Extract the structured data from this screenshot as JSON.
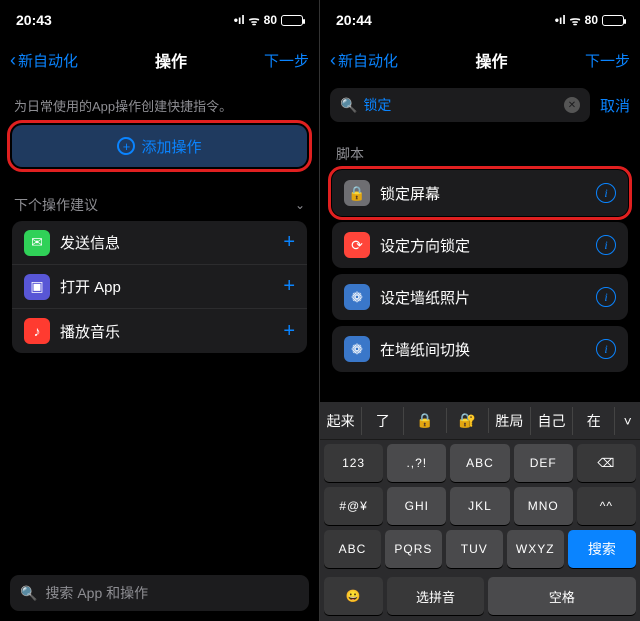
{
  "left": {
    "status": {
      "time": "20:43",
      "battery": "80"
    },
    "nav": {
      "back": "新自动化",
      "title": "操作",
      "next": "下一步"
    },
    "subtitle": "为日常使用的App操作创建快捷指令。",
    "add_action": "添加操作",
    "suggest_header": "下个操作建议",
    "suggestions": [
      {
        "label": "发送信息"
      },
      {
        "label": "打开 App"
      },
      {
        "label": "播放音乐"
      }
    ],
    "search_placeholder": "搜索 App 和操作"
  },
  "right": {
    "status": {
      "time": "20:44",
      "battery": "80"
    },
    "nav": {
      "back": "新自动化",
      "title": "操作",
      "next": "下一步"
    },
    "search": {
      "value": "锁定",
      "cancel": "取消"
    },
    "script_header": "脚本",
    "scripts": [
      {
        "label": "锁定屏幕",
        "highlight": true
      },
      {
        "label": "设定方向锁定"
      },
      {
        "label": "设定墙纸照片"
      },
      {
        "label": "在墙纸间切换"
      }
    ],
    "keyboard": {
      "suggestions": [
        "起来",
        "了",
        "🔒",
        "🔐",
        "胜局",
        "自己",
        "在",
        "˅"
      ],
      "rows": [
        [
          "123",
          ".,?!",
          "ABC",
          "DEF",
          "⌫"
        ],
        [
          "#@¥",
          "GHI",
          "JKL",
          "MNO",
          "^^"
        ],
        [
          "ABC",
          "PQRS",
          "TUV",
          "WXYZ"
        ]
      ],
      "bottom": {
        "emoji": "😀",
        "select": "选拼音",
        "space": "空格",
        "search": "搜索"
      }
    }
  }
}
